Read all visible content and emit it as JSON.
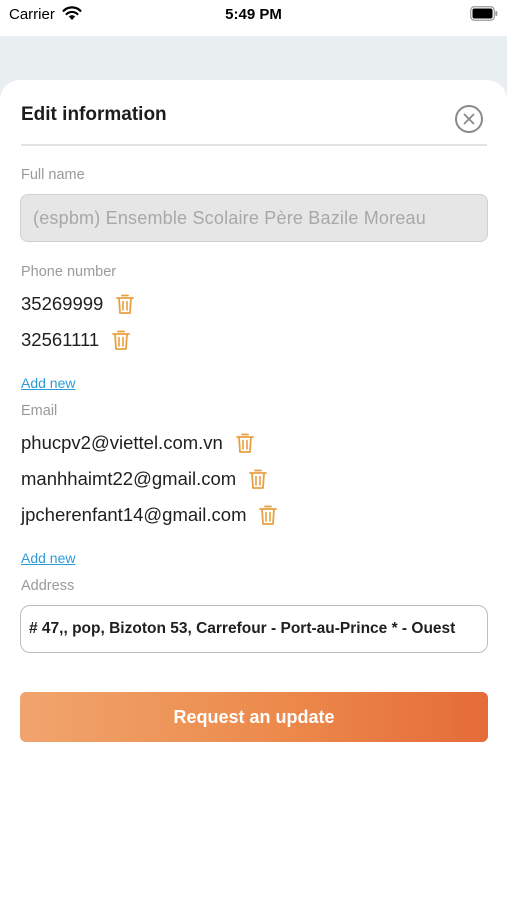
{
  "status_bar": {
    "carrier": "Carrier",
    "time": "5:49 PM",
    "icons": [
      "wifi-icon",
      "battery-icon"
    ]
  },
  "background": {
    "icons": [
      "back-arrow-icon"
    ]
  },
  "sheet": {
    "title": "Edit information",
    "close_icon": "close-icon"
  },
  "full_name": {
    "label": "Full name",
    "value": "(espbm) Ensemble Scolaire Père Bazile Moreau"
  },
  "phone": {
    "label": "Phone number",
    "items": [
      "35269999",
      "32561111"
    ],
    "add_label": "Add new",
    "item_icon": "trash-icon"
  },
  "email": {
    "label": "Email",
    "items": [
      "phucpv2@viettel.com.vn",
      "manhhaimt22@gmail.com",
      "jpcherenfant14@gmail.com"
    ],
    "add_label": "Add new",
    "item_icon": "trash-icon"
  },
  "address": {
    "label": "Address",
    "value": "# 47,, pop, Bizoton 53, Carrefour - Port-au-Prince * - Ouest"
  },
  "submit_label": "Request an update",
  "colors": {
    "accent_orange": "#ec8a4c",
    "icon_orange": "#e8a040",
    "link_blue": "#2e9bd6",
    "label_gray": "#9a9a9a"
  }
}
